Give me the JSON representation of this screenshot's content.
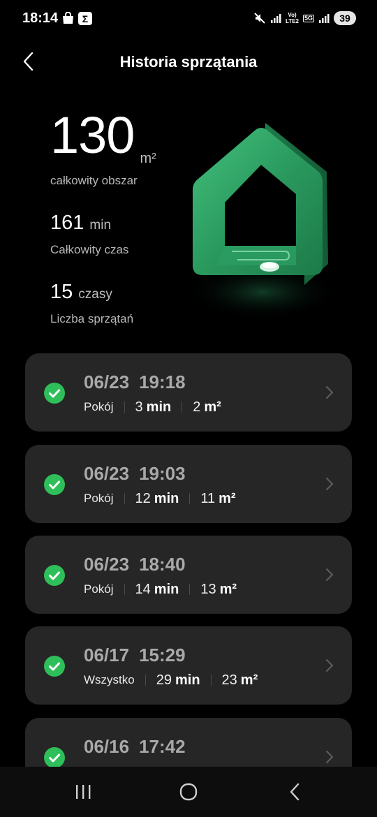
{
  "status_bar": {
    "time": "18:14",
    "sigma": "Σ",
    "lte_label_top": "Vo)",
    "lte_label_bottom": "LTE2",
    "fiveg_label": "5G",
    "battery": "39"
  },
  "header": {
    "title": "Historia sprzątania"
  },
  "summary": {
    "area_value": "130",
    "area_unit": "m²",
    "area_label": "całkowity obszar",
    "time_value": "161",
    "time_unit": "min",
    "time_label": "Całkowity czas",
    "count_value": "15",
    "count_unit": "czasy",
    "count_label": "Liczba sprzątań"
  },
  "colors": {
    "accent_green": "#2fbf5a",
    "house_green": "#2e9e63",
    "card_bg": "#262626"
  },
  "records": [
    {
      "date": "06/23",
      "time": "19:18",
      "mode": "Pokój",
      "duration": "3",
      "duration_unit": "min",
      "area": "2",
      "area_unit": "m²"
    },
    {
      "date": "06/23",
      "time": "19:03",
      "mode": "Pokój",
      "duration": "12",
      "duration_unit": "min",
      "area": "11",
      "area_unit": "m²"
    },
    {
      "date": "06/23",
      "time": "18:40",
      "mode": "Pokój",
      "duration": "14",
      "duration_unit": "min",
      "area": "13",
      "area_unit": "m²"
    },
    {
      "date": "06/17",
      "time": "15:29",
      "mode": "Wszystko",
      "duration": "29",
      "duration_unit": "min",
      "area": "23",
      "area_unit": "m²"
    },
    {
      "date": "06/16",
      "time": "17:42",
      "mode": "",
      "duration": "",
      "duration_unit": "",
      "area": "",
      "area_unit": ""
    }
  ]
}
